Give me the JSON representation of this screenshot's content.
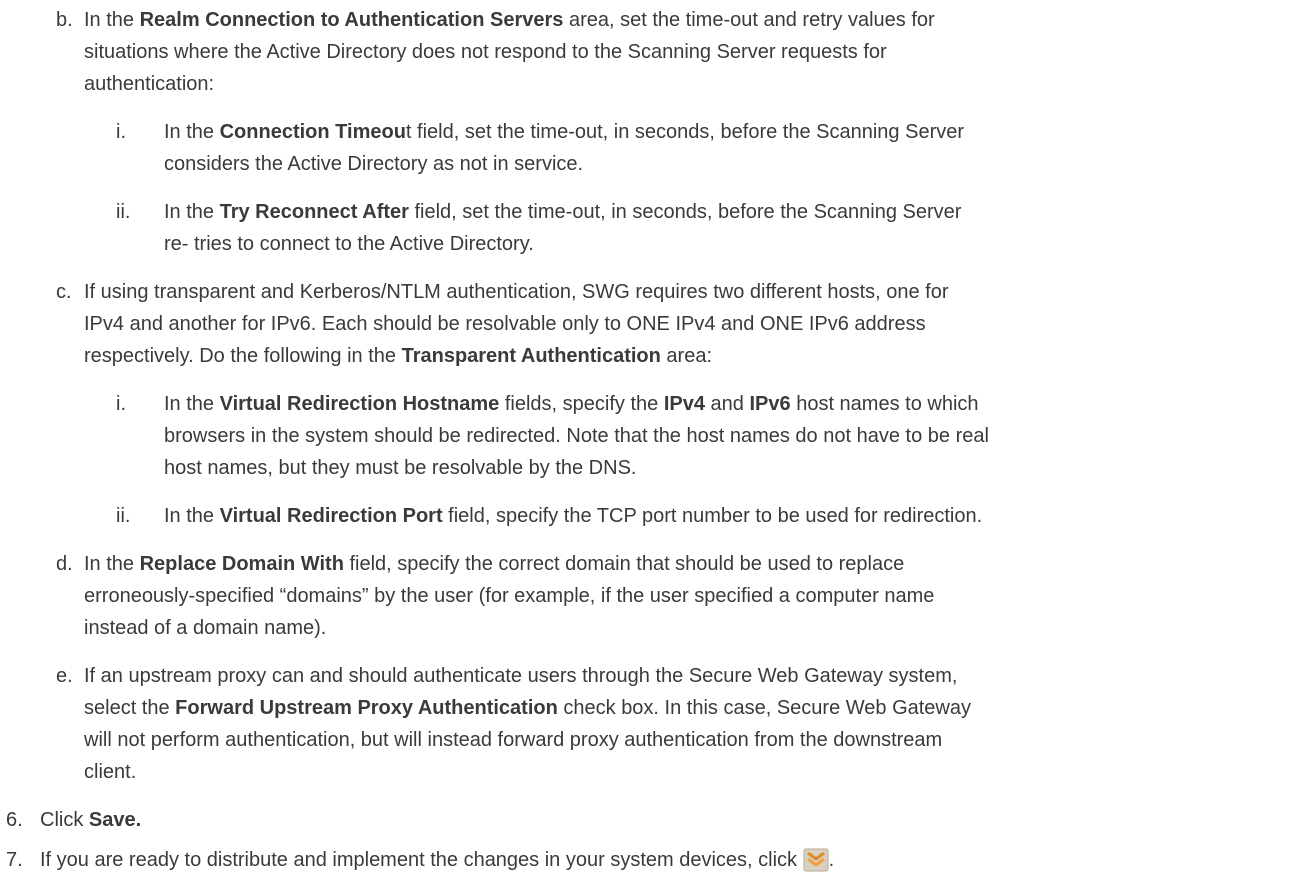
{
  "doc": {
    "b": {
      "marker": "b.",
      "l1": [
        "In the ",
        "Realm Connection to Authentication Servers",
        " area, set the time-out and retry values for"
      ],
      "l2": "situations where the Active Directory does not respond to the Scanning Server requests for",
      "l3": "authentication:",
      "i": {
        "marker": "i.",
        "l1": [
          "In the ",
          "Connection Timeou",
          "t field, set the time-out, in seconds, before the Scanning Server"
        ],
        "l2": "considers the Active Directory as not in service."
      },
      "ii": {
        "marker": "ii.",
        "l1": [
          "In the ",
          "Try Reconnect After",
          " field, set the time-out, in seconds, before the Scanning Server"
        ],
        "l2": "re- tries to connect to the Active Directory."
      }
    },
    "c": {
      "marker": "c.",
      "l1": "If using transparent and Kerberos/NTLM authentication, SWG requires two different hosts, one for",
      "l2": "IPv4 and another for IPv6. Each should be resolvable only to ONE IPv4 and ONE IPv6 address",
      "l3": [
        "respectively. Do the following in the ",
        "Transparent Authentication",
        " area:"
      ],
      "i": {
        "marker": "i.",
        "l1": [
          "In the ",
          "Virtual Redirection Hostname",
          " fields, specify the ",
          "IPv4",
          " and ",
          "IPv6",
          " host names to which"
        ],
        "l2": "browsers in the system should be redirected. Note that the host names do not have to be real",
        "l3": "host names, but they must be resolvable by the DNS."
      },
      "ii": {
        "marker": "ii.",
        "l1": [
          "In the ",
          "Virtual Redirection Port",
          " field, specify the TCP port number to be used for redirection."
        ]
      }
    },
    "d": {
      "marker": "d.",
      "l1": [
        "In the ",
        "Replace Domain With",
        " field, specify the correct domain that should be used to replace"
      ],
      "l2": "erroneously-specified “domains” by the user (for example, if the user specified a computer name",
      "l3": "instead of a domain name)."
    },
    "e": {
      "marker": "e.",
      "l1": "If an upstream proxy can and should authenticate users through the Secure Web Gateway system,",
      "l2": [
        "select the ",
        "Forward Upstream Proxy Authentication",
        " check box. In this case, Secure Web Gateway"
      ],
      "l3": "will not perform authentication, but will instead forward proxy authentication from the downstream",
      "l4": "client."
    },
    "step6": {
      "marker": "6.",
      "text": "Click ",
      "bold": "Save."
    },
    "step7": {
      "marker": "7.",
      "text": "If you are ready to distribute and implement the changes in your system devices, click ",
      "after": ".",
      "icon": "deploy-changes-icon"
    }
  }
}
